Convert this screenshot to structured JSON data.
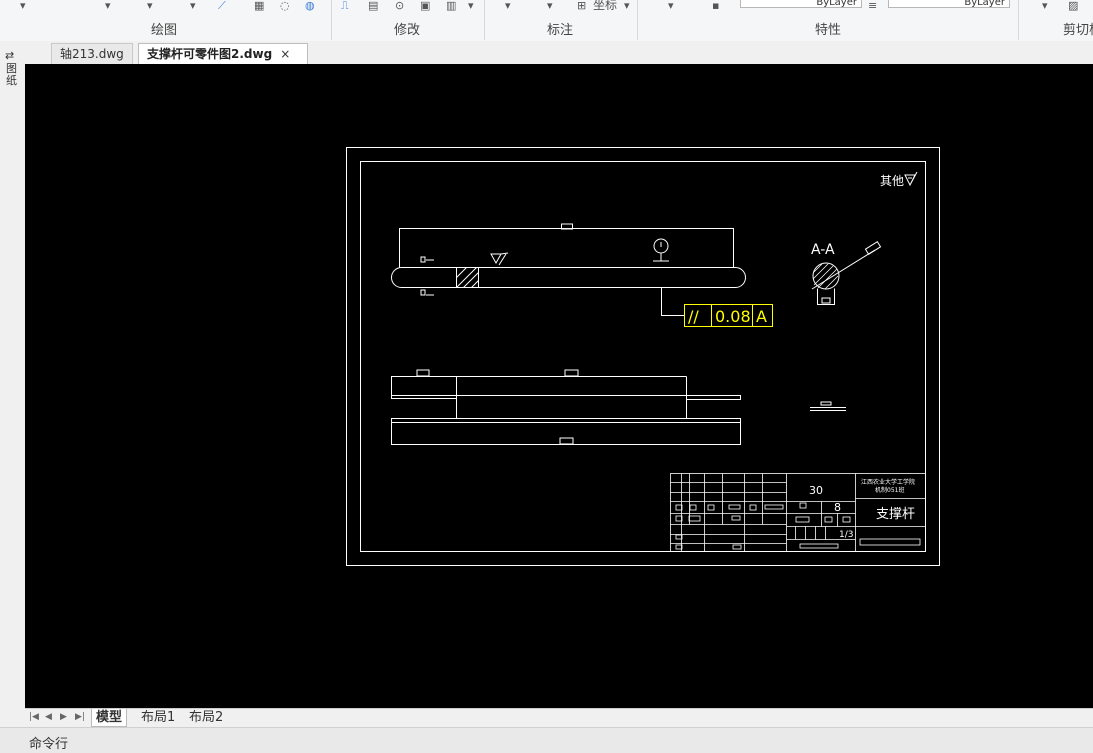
{
  "ribbon": {
    "groups": [
      {
        "label": "绘图"
      },
      {
        "label": "修改"
      },
      {
        "label": "标注"
      },
      {
        "label": "特性"
      },
      {
        "label": "剪切板"
      }
    ],
    "annotation_tool_label": "坐标",
    "layer_values": [
      "ByLayer",
      "ByLayer"
    ]
  },
  "file_tabs": [
    {
      "label": "轴213.dwg"
    },
    {
      "label": "支撑杆可零件图2.dwg"
    }
  ],
  "close_symbol": "×",
  "left_bar": {
    "label": "图纸"
  },
  "drawing": {
    "roughness_note": "其他",
    "section_label": "A-A",
    "tolerance_symbol": "//",
    "tolerance_value": "0.08",
    "datum": "A",
    "title_block": {
      "scale_number": "30",
      "quantity": "8",
      "sheet_info": "1/3",
      "school": "江西农业大学工学院",
      "class": "机制051班",
      "part_name": "支撑杆"
    }
  },
  "layout_tabs": [
    {
      "label": "模型"
    },
    {
      "label": "布局1"
    },
    {
      "label": "布局2"
    }
  ],
  "nav_arrows": [
    "|◀",
    "◀",
    "▶",
    "▶|"
  ],
  "command_line": {
    "label": "命令行"
  },
  "colors": {
    "canvas": "#000000",
    "lines": "#ffffff",
    "tolerance": "#ffff00",
    "ribbon": "#f5f6f7"
  }
}
